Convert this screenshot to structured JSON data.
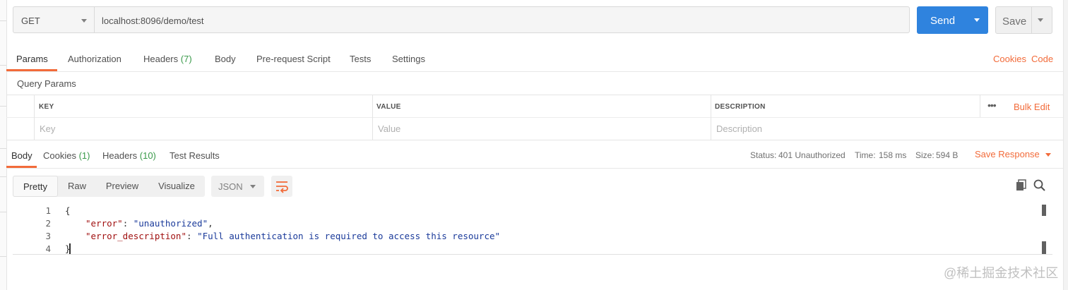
{
  "request": {
    "method": "GET",
    "url": "localhost:8096/demo/test",
    "send_label": "Send",
    "save_label": "Save"
  },
  "request_tabs": {
    "params": "Params",
    "authorization": "Authorization",
    "headers": "Headers",
    "headers_count": "(7)",
    "body": "Body",
    "pre_request": "Pre-request Script",
    "tests": "Tests",
    "settings": "Settings",
    "cookies": "Cookies",
    "code": "Code"
  },
  "query_params": {
    "title": "Query Params",
    "col_key": "KEY",
    "col_value": "VALUE",
    "col_description": "DESCRIPTION",
    "more": "•••",
    "bulk_edit": "Bulk Edit",
    "placeholder_key": "Key",
    "placeholder_value": "Value",
    "placeholder_description": "Description"
  },
  "response_tabs": {
    "body": "Body",
    "cookies": "Cookies",
    "cookies_count": "(1)",
    "headers": "Headers",
    "headers_count": "(10)",
    "test_results": "Test Results"
  },
  "response_status": {
    "status_label": "Status:",
    "status_value": "401 Unauthorized",
    "time_label": "Time:",
    "time_value": "158 ms",
    "size_label": "Size:",
    "size_value": "594 B",
    "save_response": "Save Response"
  },
  "view_modes": {
    "pretty": "Pretty",
    "raw": "Raw",
    "preview": "Preview",
    "visualize": "Visualize",
    "format": "JSON"
  },
  "code": {
    "line_numbers": [
      "1",
      "2",
      "3",
      "4"
    ],
    "open_brace": "{",
    "close_brace": "}",
    "key1": "\"error\"",
    "val1": "\"unauthorized\"",
    "key2": "\"error_description\"",
    "val2": "\"Full authentication is required to access this resource\""
  },
  "icons": {
    "wrap": "wrap-lines-icon",
    "copy": "copy-icon",
    "search": "search-icon"
  },
  "colors": {
    "accent": "#f26b3a",
    "primary": "#2f83de",
    "success": "#3a9a4a"
  },
  "watermark": "@稀土掘金技术社区"
}
